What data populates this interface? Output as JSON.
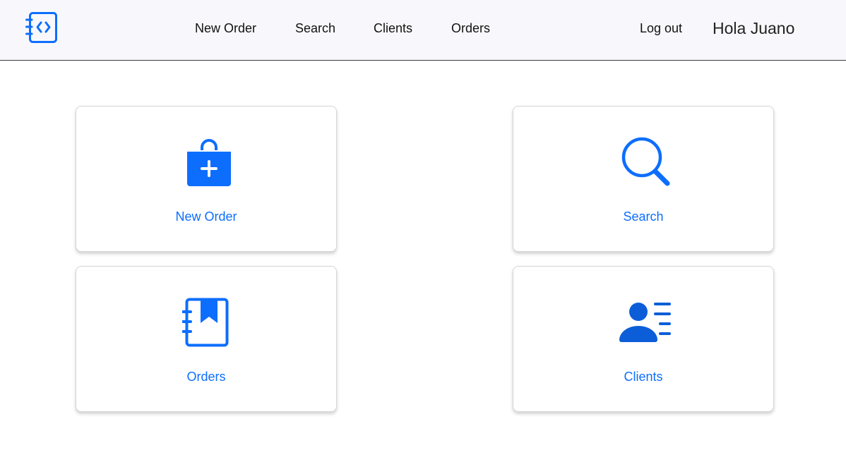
{
  "theme": {
    "accent": "#0d6efd",
    "clients_icon_color": "#0b5ed7",
    "header_bg": "#f8f8fc"
  },
  "header": {
    "logo_icon": "notebook-code-icon",
    "nav": [
      {
        "label": "New Order"
      },
      {
        "label": "Search"
      },
      {
        "label": "Clients"
      },
      {
        "label": "Orders"
      }
    ],
    "logout_label": "Log out",
    "greeting": "Hola Juano"
  },
  "tiles": [
    {
      "label": "New Order",
      "icon": "shopping-bag-plus-icon"
    },
    {
      "label": "Search",
      "icon": "magnifying-glass-icon"
    },
    {
      "label": "Orders",
      "icon": "notebook-bookmark-icon"
    },
    {
      "label": "Clients",
      "icon": "person-lines-icon"
    }
  ]
}
